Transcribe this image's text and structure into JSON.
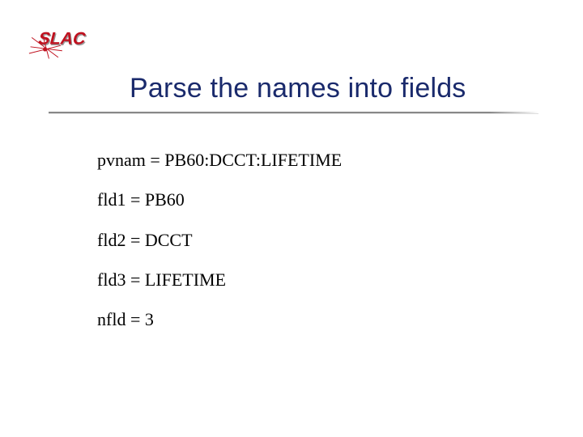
{
  "logo": {
    "text": "SLAC",
    "color_main": "#c0111f",
    "color_shadow": "#9a9a9a"
  },
  "title": "Parse the names into fields",
  "lines": {
    "pvnam": "pvnam = PB60:DCCT:LIFETIME",
    "fld1": "fld1 = PB60",
    "fld2": "fld2 = DCCT",
    "fld3": "fld3 = LIFETIME",
    "nfld": "nfld = 3"
  }
}
